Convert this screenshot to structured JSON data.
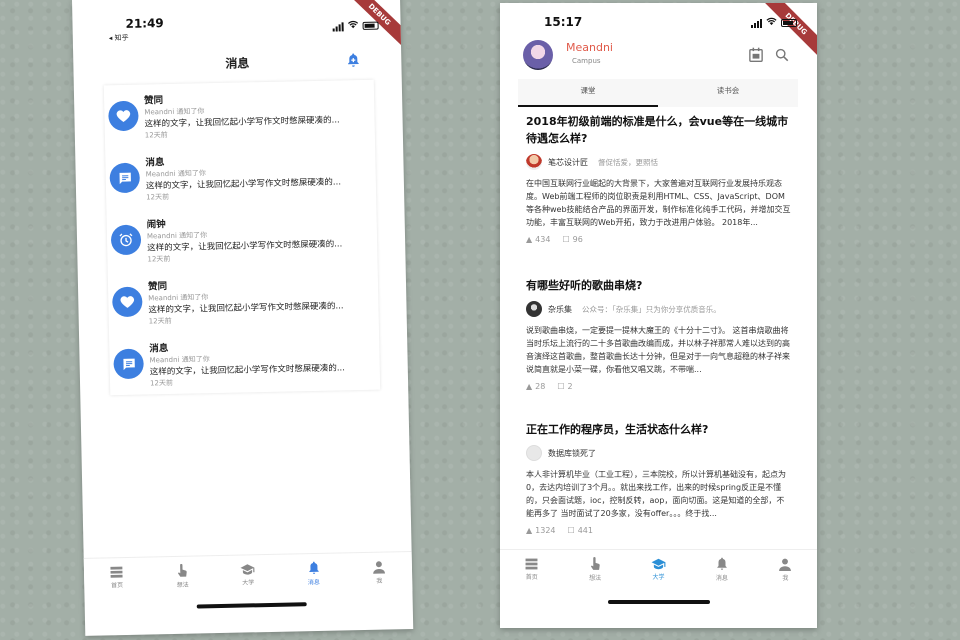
{
  "left": {
    "status": {
      "time": "21:49",
      "sub": "◂ 知乎"
    },
    "debug": "DEBUG",
    "title": "消息",
    "messages": [
      {
        "title": "赞同",
        "meta": "Meandni 通知了你",
        "text": "这样的文字，让我回忆起小学写作文时憋屎硬凑的...",
        "date": "12天前",
        "icon": "heart-icon"
      },
      {
        "title": "消息",
        "meta": "Meandni 通知了你",
        "text": "这样的文字，让我回忆起小学写作文时憋屎硬凑的...",
        "date": "12天前",
        "icon": "message-icon"
      },
      {
        "title": "闹钟",
        "meta": "Meandni 通知了你",
        "text": "这样的文字，让我回忆起小学写作文时憋屎硬凑的...",
        "date": "12天前",
        "icon": "alarm-icon"
      },
      {
        "title": "赞同",
        "meta": "Meandni 通知了你",
        "text": "这样的文字，让我回忆起小学写作文时憋屎硬凑的...",
        "date": "12天前",
        "icon": "heart-icon"
      },
      {
        "title": "消息",
        "meta": "Meandni 通知了你",
        "text": "这样的文字，让我回忆起小学写作文时憋屎硬凑的...",
        "date": "12天前",
        "icon": "message-icon"
      }
    ],
    "nav": [
      {
        "label": "首页",
        "icon": "list-icon"
      },
      {
        "label": "想法",
        "icon": "touch-icon"
      },
      {
        "label": "大学",
        "icon": "school-icon"
      },
      {
        "label": "消息",
        "icon": "bell-icon",
        "active": true
      },
      {
        "label": "我",
        "icon": "person-icon"
      }
    ]
  },
  "right": {
    "status": {
      "time": "15:17"
    },
    "debug": "DEBUG",
    "profile": {
      "name": "Meandni",
      "sub": "Campus"
    },
    "tabs": [
      {
        "label": "课堂",
        "active": true
      },
      {
        "label": "读书会"
      }
    ],
    "cards": [
      {
        "title": "2018年初级前端的标准是什么，会vue等在一线城市待遇怎么样?",
        "author": "笔芯设计匠",
        "bio": "督促恬爱，更照恬",
        "body": "在中国互联网行业崛起的大背景下，大家普遍对互联网行业发展持乐观态度。Web前端工程师的岗位职责是利用HTML、CSS、JavaScript、DOM等各种web技能结合产品的界面开发，制作标准化纯手工代码，并增加交互功能，丰富互联网的Web开拓，致力于改进用户体验。 2018年...",
        "likes": "434",
        "comments": "96"
      },
      {
        "title": "有哪些好听的歌曲串烧?",
        "author": "杂乐集",
        "bio": "公众号：「杂乐集」只为你分享优质音乐。",
        "body": "说到歌曲串烧，一定要提一提林大魔王的《十分十二寸》。 这首串烧歌曲将当时乐坛上流行的二十多首歌曲改编而成，并以林子祥那常人难以达到的高音演绎这首歌曲，整首歌曲长达十分钟，但是对于一向气息超稳的林子祥来说简直就是小菜一碟，你看他又唱又跳，不带喘...",
        "likes": "28",
        "comments": "2"
      },
      {
        "title": "正在工作的程序员，生活状态什么样?",
        "author": "数据库锁死了",
        "bio": "",
        "body": "本人非计算机毕业（工业工程），三本院校，所以计算机基础没有，起点为0，去达内培训了3个月。。就出来找工作，出来的时候spring反正是不懂的，只会面试题，ioc，控制反转，aop，面向切面。这是知道的全部，不能再多了 当时面试了20多家，没有offer。。。终于找...",
        "likes": "1324",
        "comments": "441"
      }
    ],
    "nav": [
      {
        "label": "首页",
        "icon": "list-icon"
      },
      {
        "label": "想法",
        "icon": "touch-icon"
      },
      {
        "label": "大学",
        "icon": "school-icon",
        "active": true
      },
      {
        "label": "消息",
        "icon": "bell-icon"
      },
      {
        "label": "我",
        "icon": "person-icon"
      }
    ]
  },
  "colors": {
    "accent": "#3d7fe0",
    "brand_red": "#e05a4a",
    "school_blue": "#2b8fd6"
  }
}
